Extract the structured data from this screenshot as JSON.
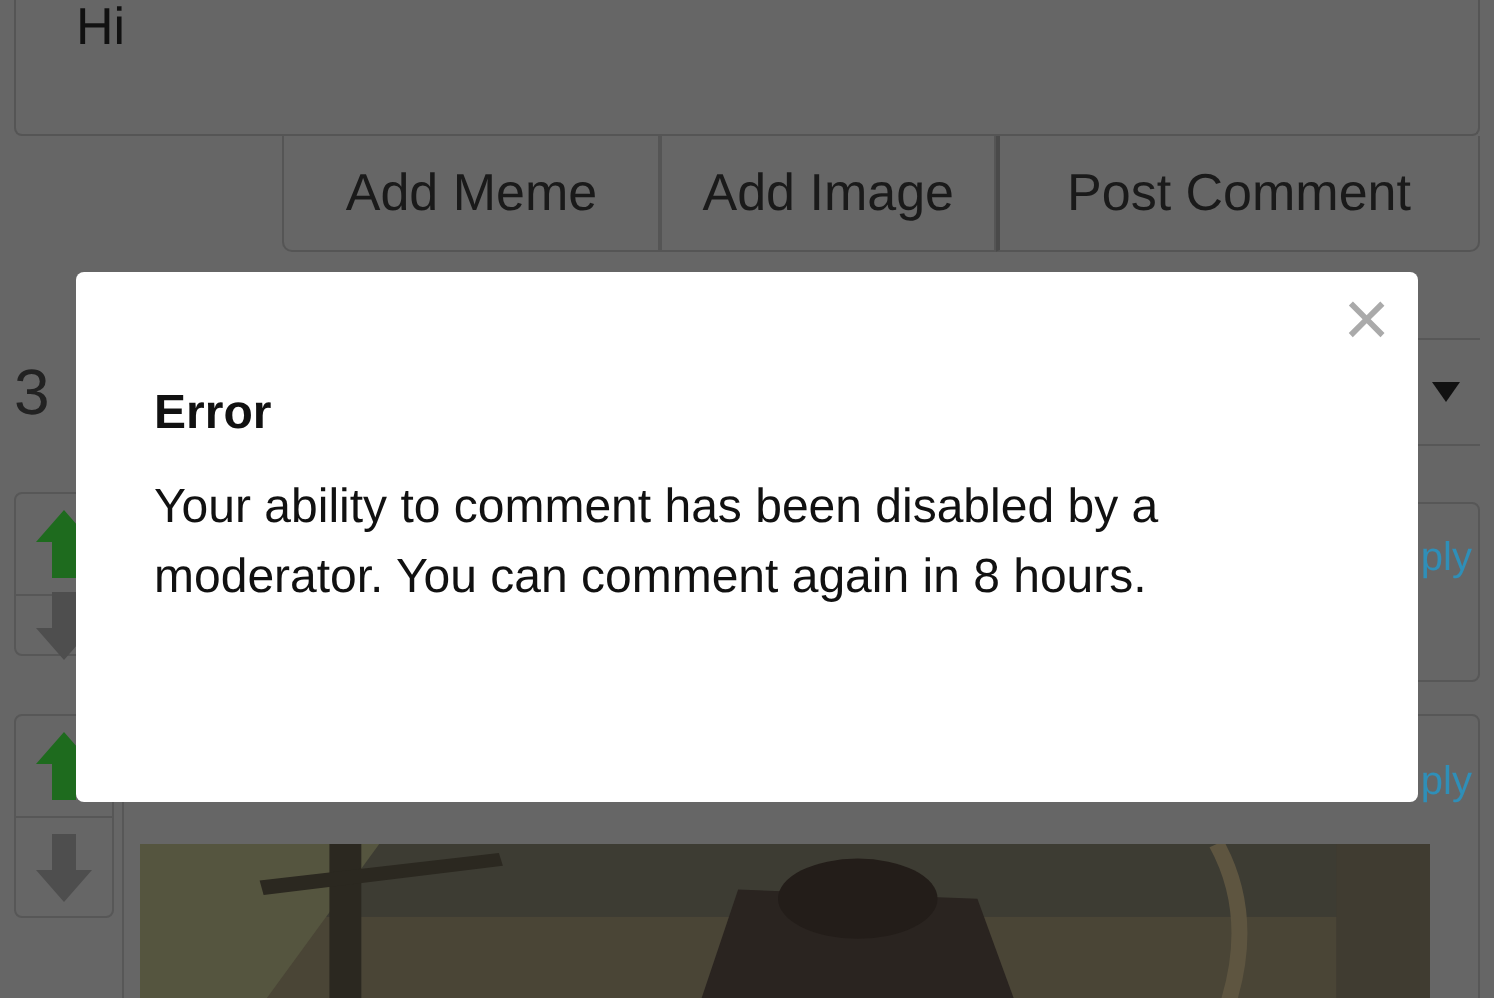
{
  "comment_box": {
    "value": "Hi"
  },
  "buttons": [
    "Add Meme",
    "Add Image",
    "Post Comment"
  ],
  "comment_count": "3",
  "comments": [
    {
      "kind": "text",
      "upvoted": true,
      "reply_link": "ply"
    },
    {
      "upvoted": true,
      "reply_link": "ply"
    }
  ],
  "modal": {
    "close": "×",
    "title": "Error",
    "message": "Your ability to comment has been disabled by a moderator. You can comment again in 8 hours."
  }
}
